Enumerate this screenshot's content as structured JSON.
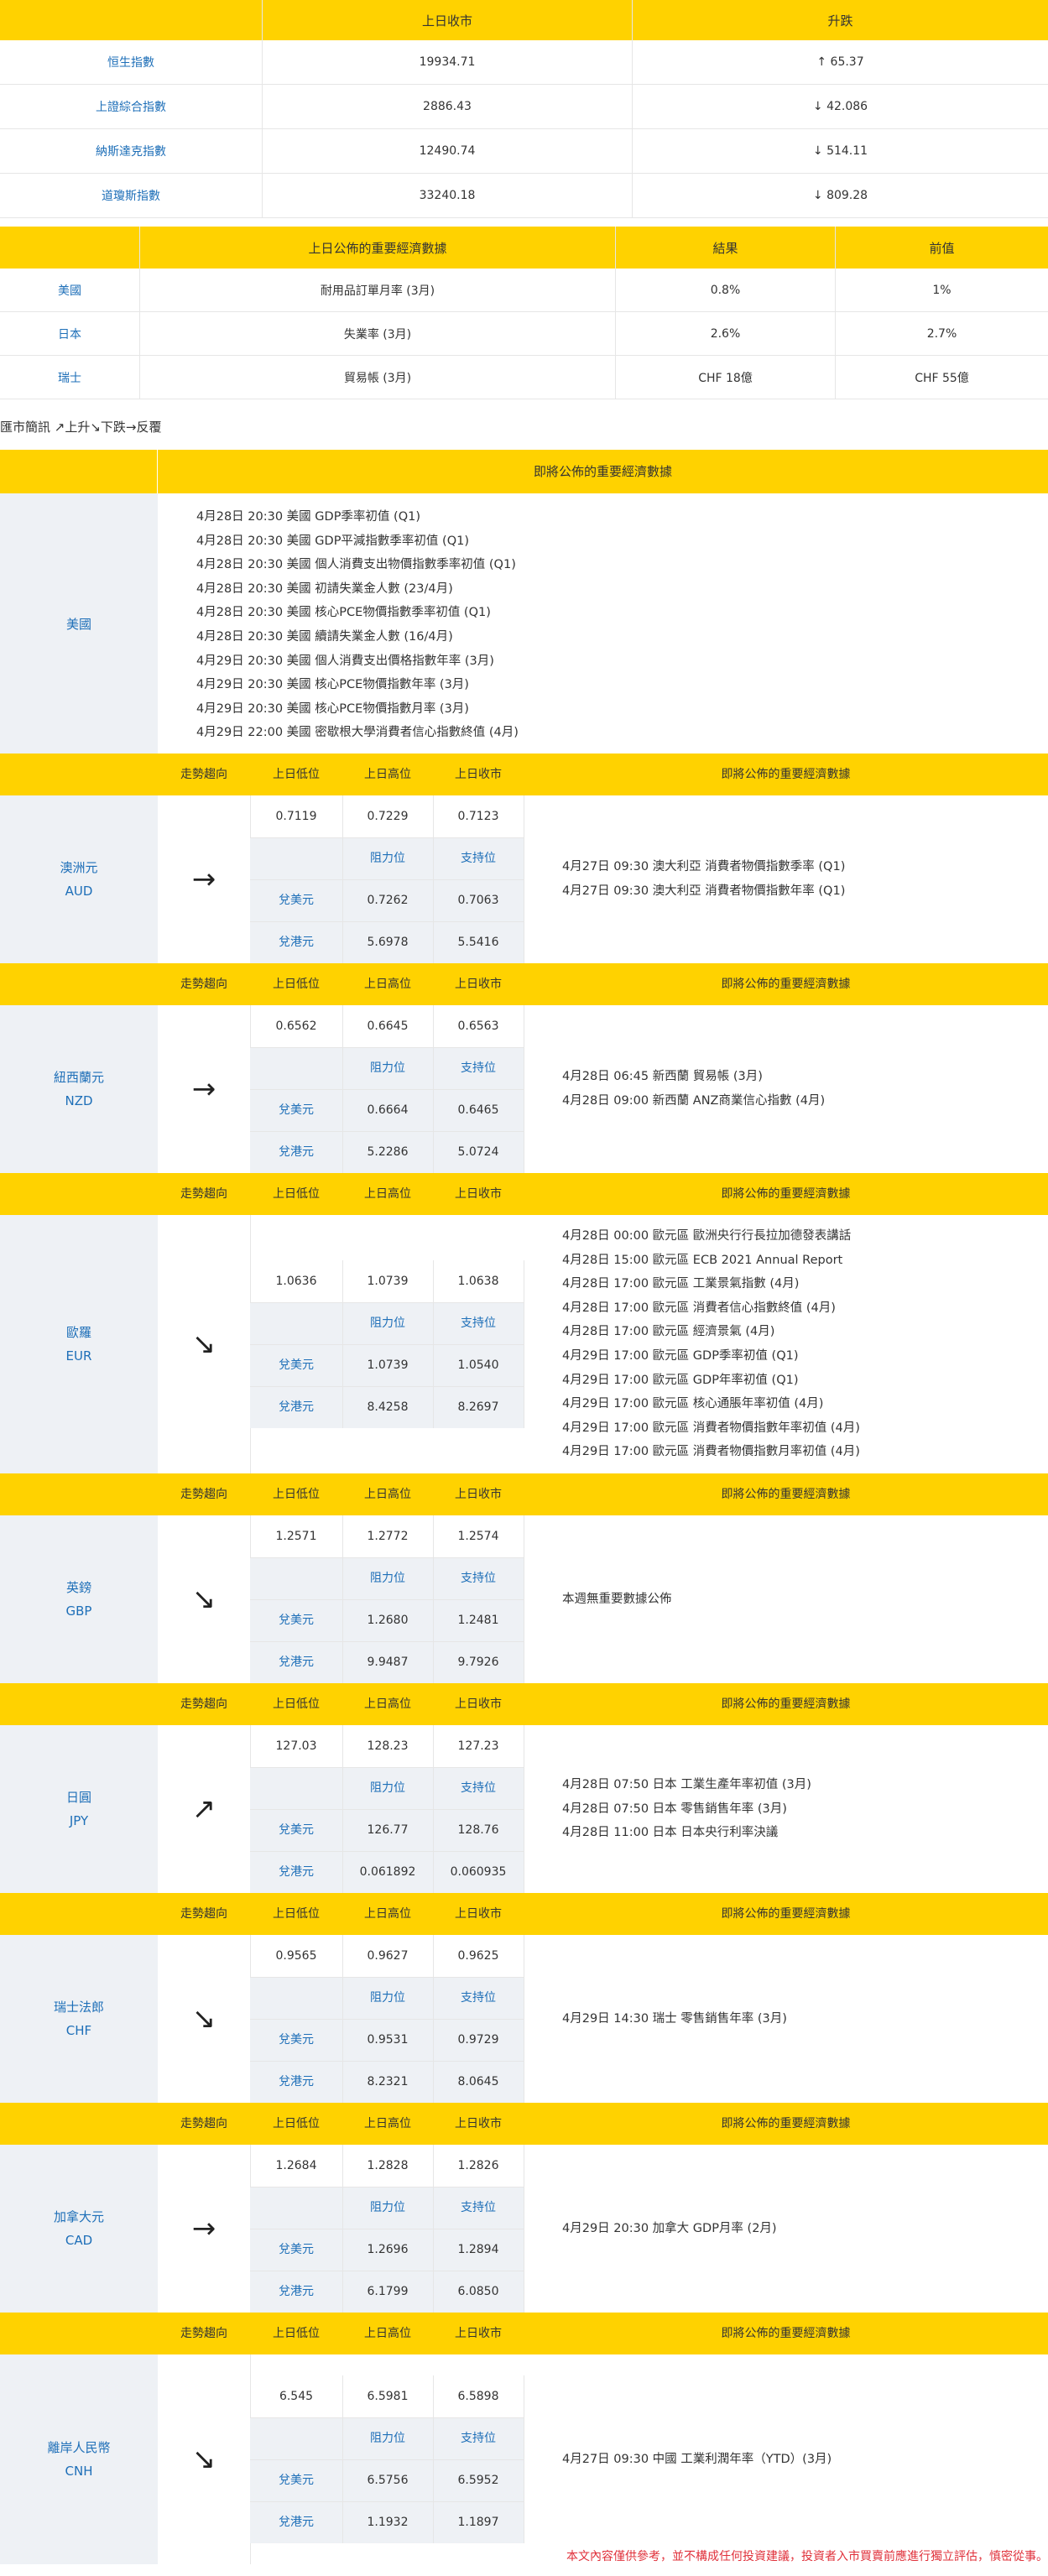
{
  "index_table": {
    "headers": [
      "",
      "上日收市",
      "升跌"
    ],
    "rows": [
      {
        "name": "恒生指數",
        "close": "19934.71",
        "change": "↑ 65.37"
      },
      {
        "name": "上證綜合指數",
        "close": "2886.43",
        "change": "↓ 42.086"
      },
      {
        "name": "納斯達克指數",
        "close": "12490.74",
        "change": "↓ 514.11"
      },
      {
        "name": "道瓊斯指數",
        "close": "33240.18",
        "change": "↓ 809.28"
      }
    ]
  },
  "eco_table": {
    "headers": [
      "",
      "上日公佈的重要經濟數據",
      "結果",
      "前值"
    ],
    "rows": [
      {
        "country": "美國",
        "item": "耐用品訂單月率 (3月)",
        "result": "0.8%",
        "prev": "1%"
      },
      {
        "country": "日本",
        "item": "失業率 (3月)",
        "result": "2.6%",
        "prev": "2.7%"
      },
      {
        "country": "瑞士",
        "item": "貿易帳 (3月)",
        "result": "CHF 18億",
        "prev": "CHF 55億"
      }
    ]
  },
  "legend": "匯市簡訊 ↗上升↘下跌→反覆",
  "us_block": {
    "header": "即將公佈的重要經濟數據",
    "country": "美國",
    "events": [
      "4月28日 20:30  美國 GDP季率初值 (Q1)",
      "4月28日 20:30  美國 GDP平減指數季率初值 (Q1)",
      "4月28日 20:30  美國 個人消費支出物價指數季率初值 (Q1)",
      "4月28日 20:30  美國 初請失業金人數 (23/4月)",
      "4月28日 20:30  美國 核心PCE物價指數季率初值 (Q1)",
      "4月28日 20:30  美國 續請失業金人數 (16/4月)",
      "4月29日 20:30  美國 個人消費支出價格指數年率 (3月)",
      "4月29日 20:30  美國 核心PCE物價指數年率 (3月)",
      "4月29日 20:30  美國 核心PCE物價指數月率 (3月)",
      "4月29日 22:00  美國 密歇根大學消費者信心指數終值 (4月)"
    ]
  },
  "currency_headers": {
    "trend": "走勢趨向",
    "low": "上日低位",
    "high": "上日高位",
    "close": "上日收市",
    "upcoming": "即將公佈的重要經濟數據",
    "resistance": "阻力位",
    "support": "支持位"
  },
  "currencies": [
    {
      "name": "澳洲元",
      "code": "AUD",
      "trend": "→",
      "low": "0.7119",
      "high": "0.7229",
      "close": "0.7123",
      "rows": [
        {
          "label": "兌美元",
          "r": "0.7262",
          "s": "0.7063"
        },
        {
          "label": "兌港元",
          "r": "5.6978",
          "s": "5.5416"
        }
      ],
      "events": [
        "4月27日 09:30  澳大利亞 消費者物價指數季率 (Q1)",
        "4月27日 09:30  澳大利亞 消費者物價指數年率 (Q1)"
      ]
    },
    {
      "name": "紐西蘭元",
      "code": "NZD",
      "trend": "→",
      "low": "0.6562",
      "high": "0.6645",
      "close": "0.6563",
      "rows": [
        {
          "label": "兌美元",
          "r": "0.6664",
          "s": "0.6465"
        },
        {
          "label": "兌港元",
          "r": "5.2286",
          "s": "5.0724"
        }
      ],
      "events": [
        "4月28日 06:45  新西蘭 貿易帳 (3月)",
        "4月28日 09:00  新西蘭 ANZ商業信心指數 (4月)"
      ]
    },
    {
      "name": "歐羅",
      "code": "EUR",
      "trend": "↘",
      "low": "1.0636",
      "high": "1.0739",
      "close": "1.0638",
      "rows": [
        {
          "label": "兌美元",
          "r": "1.0739",
          "s": "1.0540"
        },
        {
          "label": "兌港元",
          "r": "8.4258",
          "s": "8.2697"
        }
      ],
      "events": [
        "4月28日 00:00  歐元區 歐洲央行行長拉加德發表講話",
        "4月28日 15:00  歐元區 ECB 2021 Annual Report",
        "4月28日 17:00  歐元區 工業景氣指數 (4月)",
        "4月28日 17:00  歐元區 消費者信心指數終值 (4月)",
        "4月28日 17:00  歐元區 經濟景氣 (4月)",
        "4月29日 17:00  歐元區 GDP季率初值 (Q1)",
        "4月29日 17:00  歐元區 GDP年率初值 (Q1)",
        "4月29日 17:00  歐元區 核心通脹年率初值 (4月)",
        "4月29日 17:00  歐元區 消費者物價指數年率初值 (4月)",
        "4月29日 17:00  歐元區 消費者物價指數月率初值 (4月)"
      ]
    },
    {
      "name": "英鎊",
      "code": "GBP",
      "trend": "↘",
      "low": "1.2571",
      "high": "1.2772",
      "close": "1.2574",
      "rows": [
        {
          "label": "兌美元",
          "r": "1.2680",
          "s": "1.2481"
        },
        {
          "label": "兌港元",
          "r": "9.9487",
          "s": "9.7926"
        }
      ],
      "events": [
        "本週無重要數據公佈"
      ]
    },
    {
      "name": "日圓",
      "code": "JPY",
      "trend": "↗",
      "low": "127.03",
      "high": "128.23",
      "close": "127.23",
      "rows": [
        {
          "label": "兌美元",
          "r": "126.77",
          "s": "128.76"
        },
        {
          "label": "兌港元",
          "r": "0.061892",
          "s": "0.060935"
        }
      ],
      "events": [
        "4月28日 07:50  日本 工業生產年率初值 (3月)",
        "4月28日 07:50  日本 零售銷售年率 (3月)",
        "4月28日 11:00  日本 日本央行利率決議"
      ]
    },
    {
      "name": "瑞士法郎",
      "code": "CHF",
      "trend": "↘",
      "low": "0.9565",
      "high": "0.9627",
      "close": "0.9625",
      "rows": [
        {
          "label": "兌美元",
          "r": "0.9531",
          "s": "0.9729"
        },
        {
          "label": "兌港元",
          "r": "8.2321",
          "s": "8.0645"
        }
      ],
      "events": [
        "4月29日 14:30  瑞士 零售銷售年率 (3月)"
      ]
    },
    {
      "name": "加拿大元",
      "code": "CAD",
      "trend": "→",
      "low": "1.2684",
      "high": "1.2828",
      "close": "1.2826",
      "rows": [
        {
          "label": "兌美元",
          "r": "1.2696",
          "s": "1.2894"
        },
        {
          "label": "兌港元",
          "r": "6.1799",
          "s": "6.0850"
        }
      ],
      "events": [
        "4月29日 20:30  加拿大 GDP月率 (2月)"
      ]
    },
    {
      "name": "離岸人民幣",
      "code": "CNH",
      "trend": "↘",
      "low": "6.545",
      "high": "6.5981",
      "close": "6.5898",
      "rows": [
        {
          "label": "兌美元",
          "r": "6.5756",
          "s": "6.5952"
        },
        {
          "label": "兌港元",
          "r": "1.1932",
          "s": "1.1897"
        }
      ],
      "events": [
        "4月27日 09:30  中國 工業利潤年率（YTD）(3月)"
      ]
    }
  ],
  "disclaimer": "本文內容僅供參考，並不構成任何投資建議，投資者入市買賣前應進行獨立評估，慎密從事。"
}
